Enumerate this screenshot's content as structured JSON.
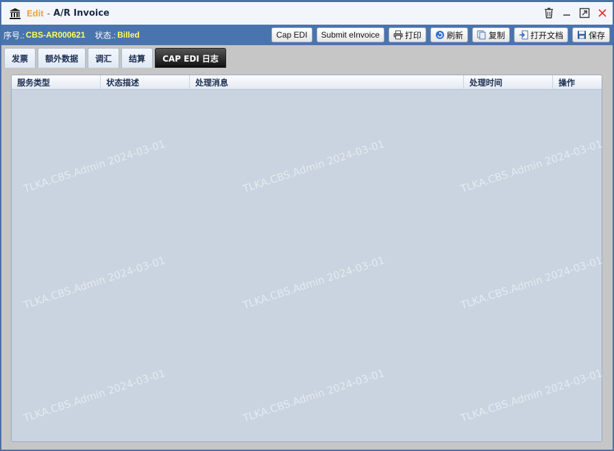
{
  "window": {
    "edit_label": "Edit",
    "separator": "-",
    "title": "A/R Invoice"
  },
  "toolbar": {
    "seq_label": "序号.:",
    "seq_value": "CBS-AR000621",
    "status_label": "状态.:",
    "status_value": "Billed",
    "buttons": {
      "cap_edi": "Cap EDI",
      "submit_einvoice": "Submit eInvoice",
      "print": "打印",
      "refresh": "刷新",
      "copy": "复制",
      "open_doc": "打开文档",
      "save": "保存"
    }
  },
  "tabs": [
    {
      "label": "发票",
      "active": false
    },
    {
      "label": "额外数据",
      "active": false
    },
    {
      "label": "调汇",
      "active": false
    },
    {
      "label": "结算",
      "active": false
    },
    {
      "label": "CAP EDI 日志",
      "active": true
    }
  ],
  "grid": {
    "columns": [
      "服务类型",
      "状态描述",
      "处理消息",
      "处理时间",
      "操作"
    ]
  },
  "watermark": "TLKA.CBS.Admin 2024-03-01",
  "colors": {
    "accent": "#4a74ad",
    "status_value": "#ffff66",
    "edit_label": "#f0a030",
    "close_icon": "#e03030"
  }
}
